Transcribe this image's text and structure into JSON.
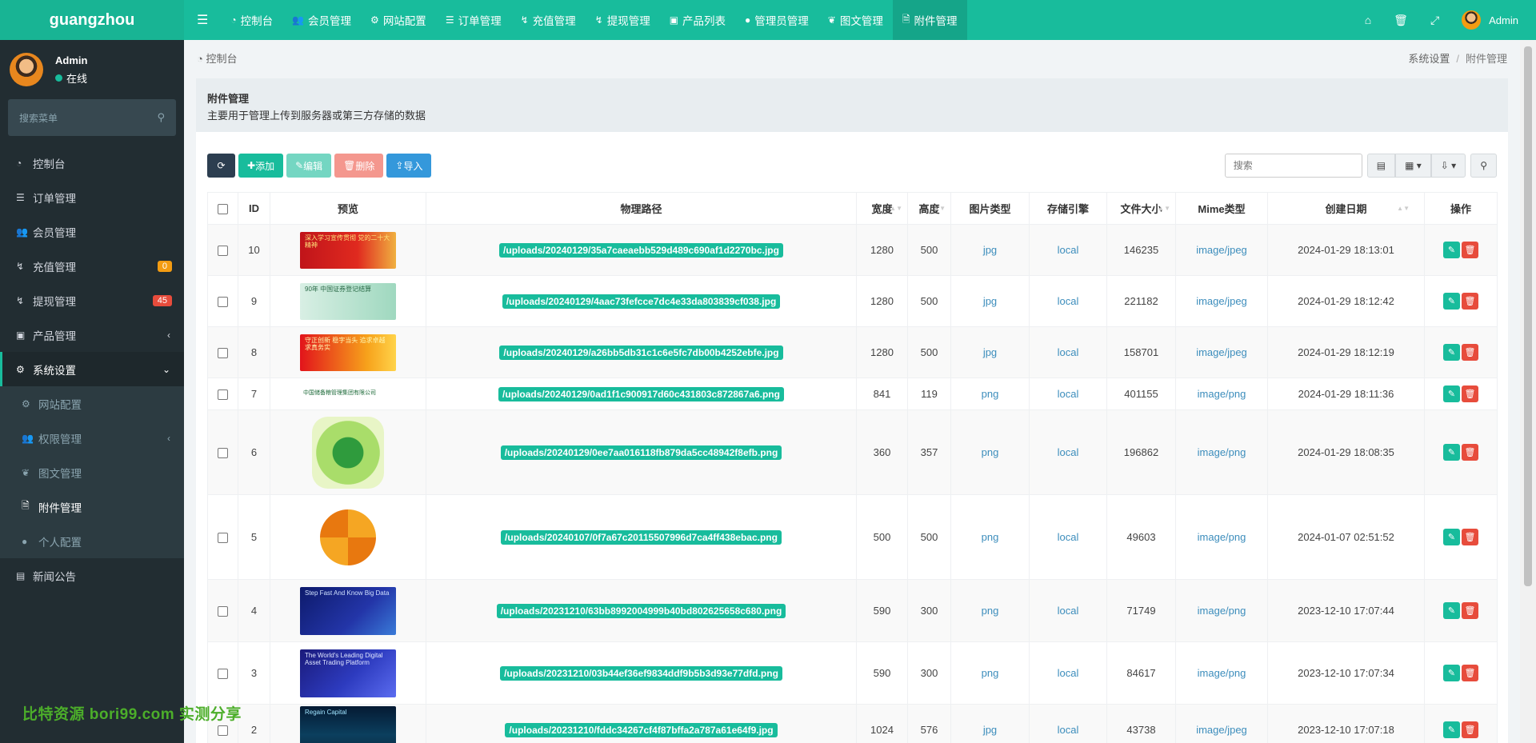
{
  "brand": "guangzhou",
  "topnav": {
    "items": [
      {
        "icon": "dashboard-icon",
        "label": "控制台"
      },
      {
        "icon": "users-icon",
        "label": "会员管理"
      },
      {
        "icon": "gear-icon",
        "label": "网站配置"
      },
      {
        "icon": "list-icon",
        "label": "订单管理"
      },
      {
        "icon": "recharge-icon",
        "label": "充值管理"
      },
      {
        "icon": "withdraw-icon",
        "label": "提现管理"
      },
      {
        "icon": "shopping-bag-icon",
        "label": "产品列表"
      },
      {
        "icon": "user-icon",
        "label": "管理员管理"
      },
      {
        "icon": "leaf-icon",
        "label": "图文管理"
      },
      {
        "icon": "file-image-icon",
        "label": "附件管理"
      }
    ],
    "user_name": "Admin"
  },
  "sidebar": {
    "user_name": "Admin",
    "status": "在线",
    "search_placeholder": "搜索菜单",
    "items": [
      {
        "icon": "dashboard-icon",
        "label": "控制台"
      },
      {
        "icon": "list-icon",
        "label": "订单管理"
      },
      {
        "icon": "users-icon",
        "label": "会员管理"
      },
      {
        "icon": "recharge-icon",
        "label": "充值管理",
        "badge": "0",
        "badge_color": "#f39c12"
      },
      {
        "icon": "withdraw-icon",
        "label": "提现管理",
        "badge": "45",
        "badge_color": "#e74c3c"
      },
      {
        "icon": "cube-icon",
        "label": "产品管理"
      },
      {
        "icon": "cogs-icon",
        "label": "系统设置"
      }
    ],
    "sub_items": [
      {
        "icon": "gear-icon",
        "label": "网站配置"
      },
      {
        "icon": "users-icon",
        "label": "权限管理"
      },
      {
        "icon": "leaf-icon",
        "label": "图文管理"
      },
      {
        "icon": "file-image-icon",
        "label": "附件管理"
      },
      {
        "icon": "user-icon",
        "label": "个人配置"
      }
    ],
    "last_item": {
      "icon": "newspaper-icon",
      "label": "新闻公告"
    }
  },
  "watermark": "比特资源 bori99.com 实测分享",
  "breadcrumb": {
    "left": "控制台",
    "parent": "系统设置",
    "current": "附件管理"
  },
  "panel": {
    "title": "附件管理",
    "description": "主要用于管理上传到服务器或第三方存储的数据"
  },
  "toolbar": {
    "add": "添加",
    "edit": "编辑",
    "delete": "删除",
    "import": "导入",
    "search_placeholder": "搜索"
  },
  "table": {
    "headers": [
      "ID",
      "预览",
      "物理路径",
      "宽度",
      "高度",
      "图片类型",
      "存储引擎",
      "文件大小",
      "Mime类型",
      "创建日期",
      "操作"
    ],
    "rows": [
      {
        "id": "10",
        "path": "/uploads/20240129/35a7caeaebb529d489c690af1d2270bc.jpg",
        "width": "1280",
        "height": "500",
        "type": "jpg",
        "storage": "local",
        "size": "146235",
        "mime": "image/jpeg",
        "date": "2024-01-29 18:13:01",
        "thumb_text": "深入学习宣传贯彻 党的二十大精神"
      },
      {
        "id": "9",
        "path": "/uploads/20240129/4aac73fefcce7dc4e33da803839cf038.jpg",
        "width": "1280",
        "height": "500",
        "type": "jpg",
        "storage": "local",
        "size": "221182",
        "mime": "image/jpeg",
        "date": "2024-01-29 18:12:42",
        "thumb_text": "90年 中国证券登记结算"
      },
      {
        "id": "8",
        "path": "/uploads/20240129/a26bb5db31c1c6e5fc7db00b4252ebfe.jpg",
        "width": "1280",
        "height": "500",
        "type": "jpg",
        "storage": "local",
        "size": "158701",
        "mime": "image/jpeg",
        "date": "2024-01-29 18:12:19",
        "thumb_text": "守正创新 稳字当头 追求卓越 求真务实"
      },
      {
        "id": "7",
        "path": "/uploads/20240129/0ad1f1c900917d60c431803c872867a6.png",
        "width": "841",
        "height": "119",
        "type": "png",
        "storage": "local",
        "size": "401155",
        "mime": "image/png",
        "date": "2024-01-29 18:11:36",
        "thumb_text": "中国储备粮管理集团有限公司"
      },
      {
        "id": "6",
        "path": "/uploads/20240129/0ee7aa016118fb879da5cc48942f8efb.png",
        "width": "360",
        "height": "357",
        "type": "png",
        "storage": "local",
        "size": "196862",
        "mime": "image/png",
        "date": "2024-01-29 18:08:35",
        "thumb_text": ""
      },
      {
        "id": "5",
        "path": "/uploads/20240107/0f7a67c20115507996d7ca4ff438ebac.png",
        "width": "500",
        "height": "500",
        "type": "png",
        "storage": "local",
        "size": "49603",
        "mime": "image/png",
        "date": "2024-01-07 02:51:52",
        "thumb_text": ""
      },
      {
        "id": "4",
        "path": "/uploads/20231210/63bb8992004999b40bd802625658c680.png",
        "width": "590",
        "height": "300",
        "type": "png",
        "storage": "local",
        "size": "71749",
        "mime": "image/png",
        "date": "2023-12-10 17:07:44",
        "thumb_text": "Step Fast And Know Big Data"
      },
      {
        "id": "3",
        "path": "/uploads/20231210/03b44ef36ef9834ddf9b5b3d93e77dfd.png",
        "width": "590",
        "height": "300",
        "type": "png",
        "storage": "local",
        "size": "84617",
        "mime": "image/png",
        "date": "2023-12-10 17:07:34",
        "thumb_text": "The World's Leading Digital Asset Trading Platform"
      },
      {
        "id": "2",
        "path": "/uploads/20231210/fddc34267cf4f87bffa2a787a61e64f9.jpg",
        "width": "1024",
        "height": "576",
        "type": "jpg",
        "storage": "local",
        "size": "43738",
        "mime": "image/jpeg",
        "date": "2023-12-10 17:07:18",
        "thumb_text": "Regain Capital"
      }
    ]
  }
}
